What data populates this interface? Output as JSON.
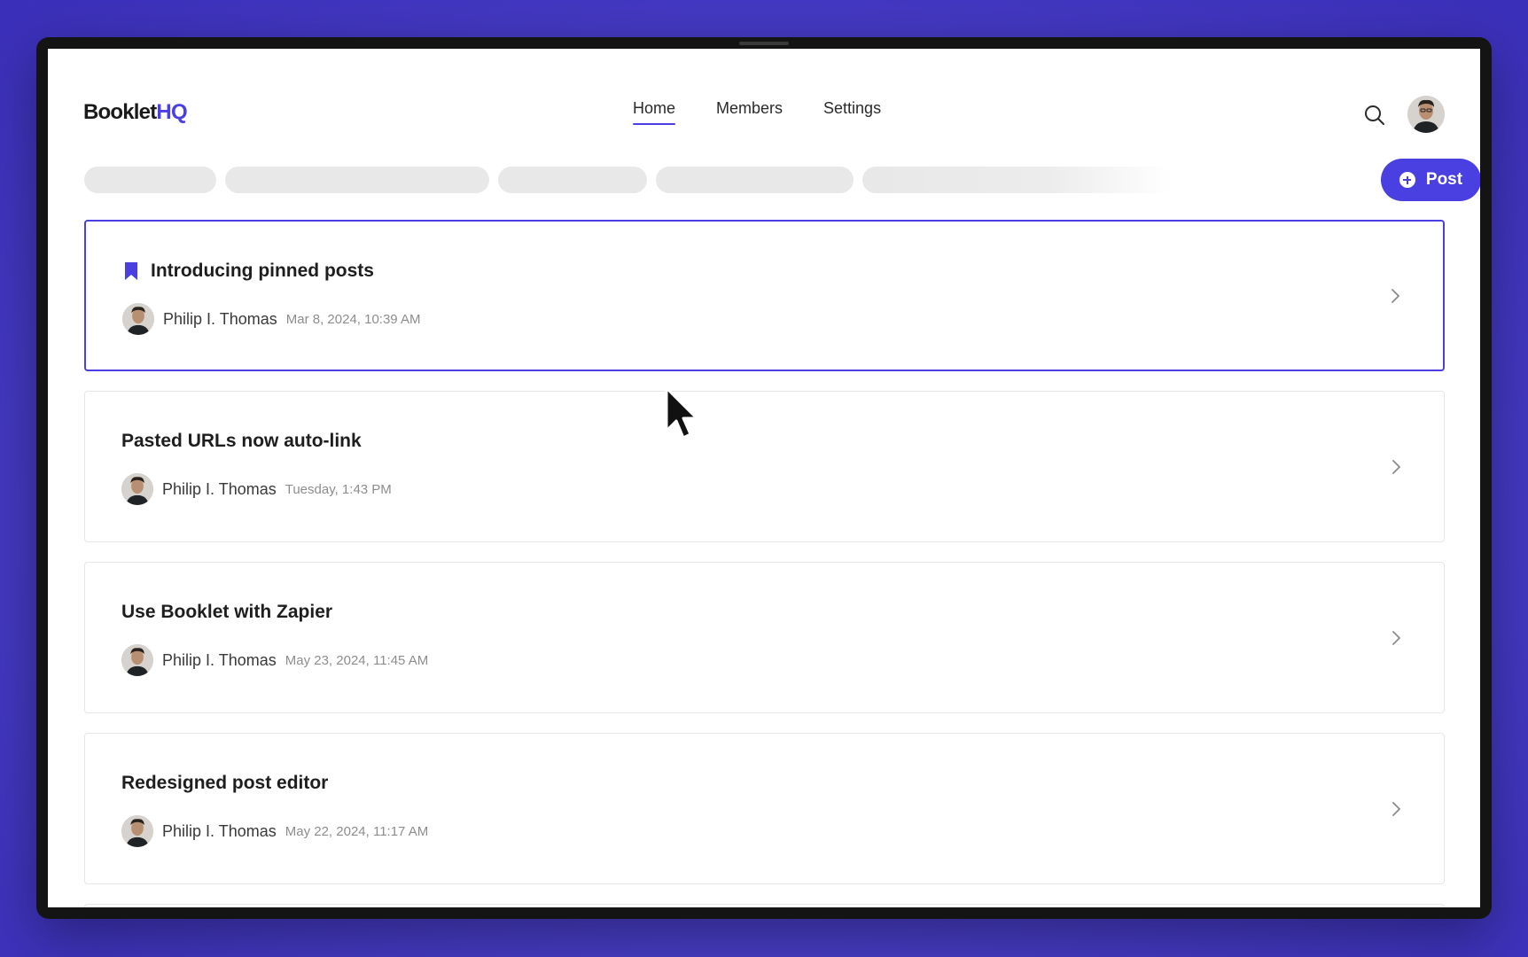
{
  "app": {
    "logo_main": "Booklet",
    "logo_accent": "HQ"
  },
  "nav": {
    "items": [
      {
        "label": "Home",
        "active": true
      },
      {
        "label": "Members",
        "active": false
      },
      {
        "label": "Settings",
        "active": false
      }
    ]
  },
  "header": {
    "search_icon": "search-icon",
    "avatar": "user-avatar"
  },
  "toolbar": {
    "post_label": "Post",
    "post_icon": "plus-circle-icon"
  },
  "colors": {
    "accent": "#4a3fe0",
    "background": "#4a40c8"
  },
  "posts": [
    {
      "title": "Introducing pinned posts",
      "author": "Philip I. Thomas",
      "time": "Mar 8, 2024, 10:39 AM",
      "pinned": true
    },
    {
      "title": "Pasted URLs now auto-link",
      "author": "Philip I. Thomas",
      "time": "Tuesday, 1:43 PM",
      "pinned": false
    },
    {
      "title": "Use Booklet with Zapier",
      "author": "Philip I. Thomas",
      "time": "May 23, 2024, 11:45 AM",
      "pinned": false
    },
    {
      "title": "Redesigned post editor",
      "author": "Philip I. Thomas",
      "time": "May 22, 2024, 11:17 AM",
      "pinned": false
    }
  ]
}
